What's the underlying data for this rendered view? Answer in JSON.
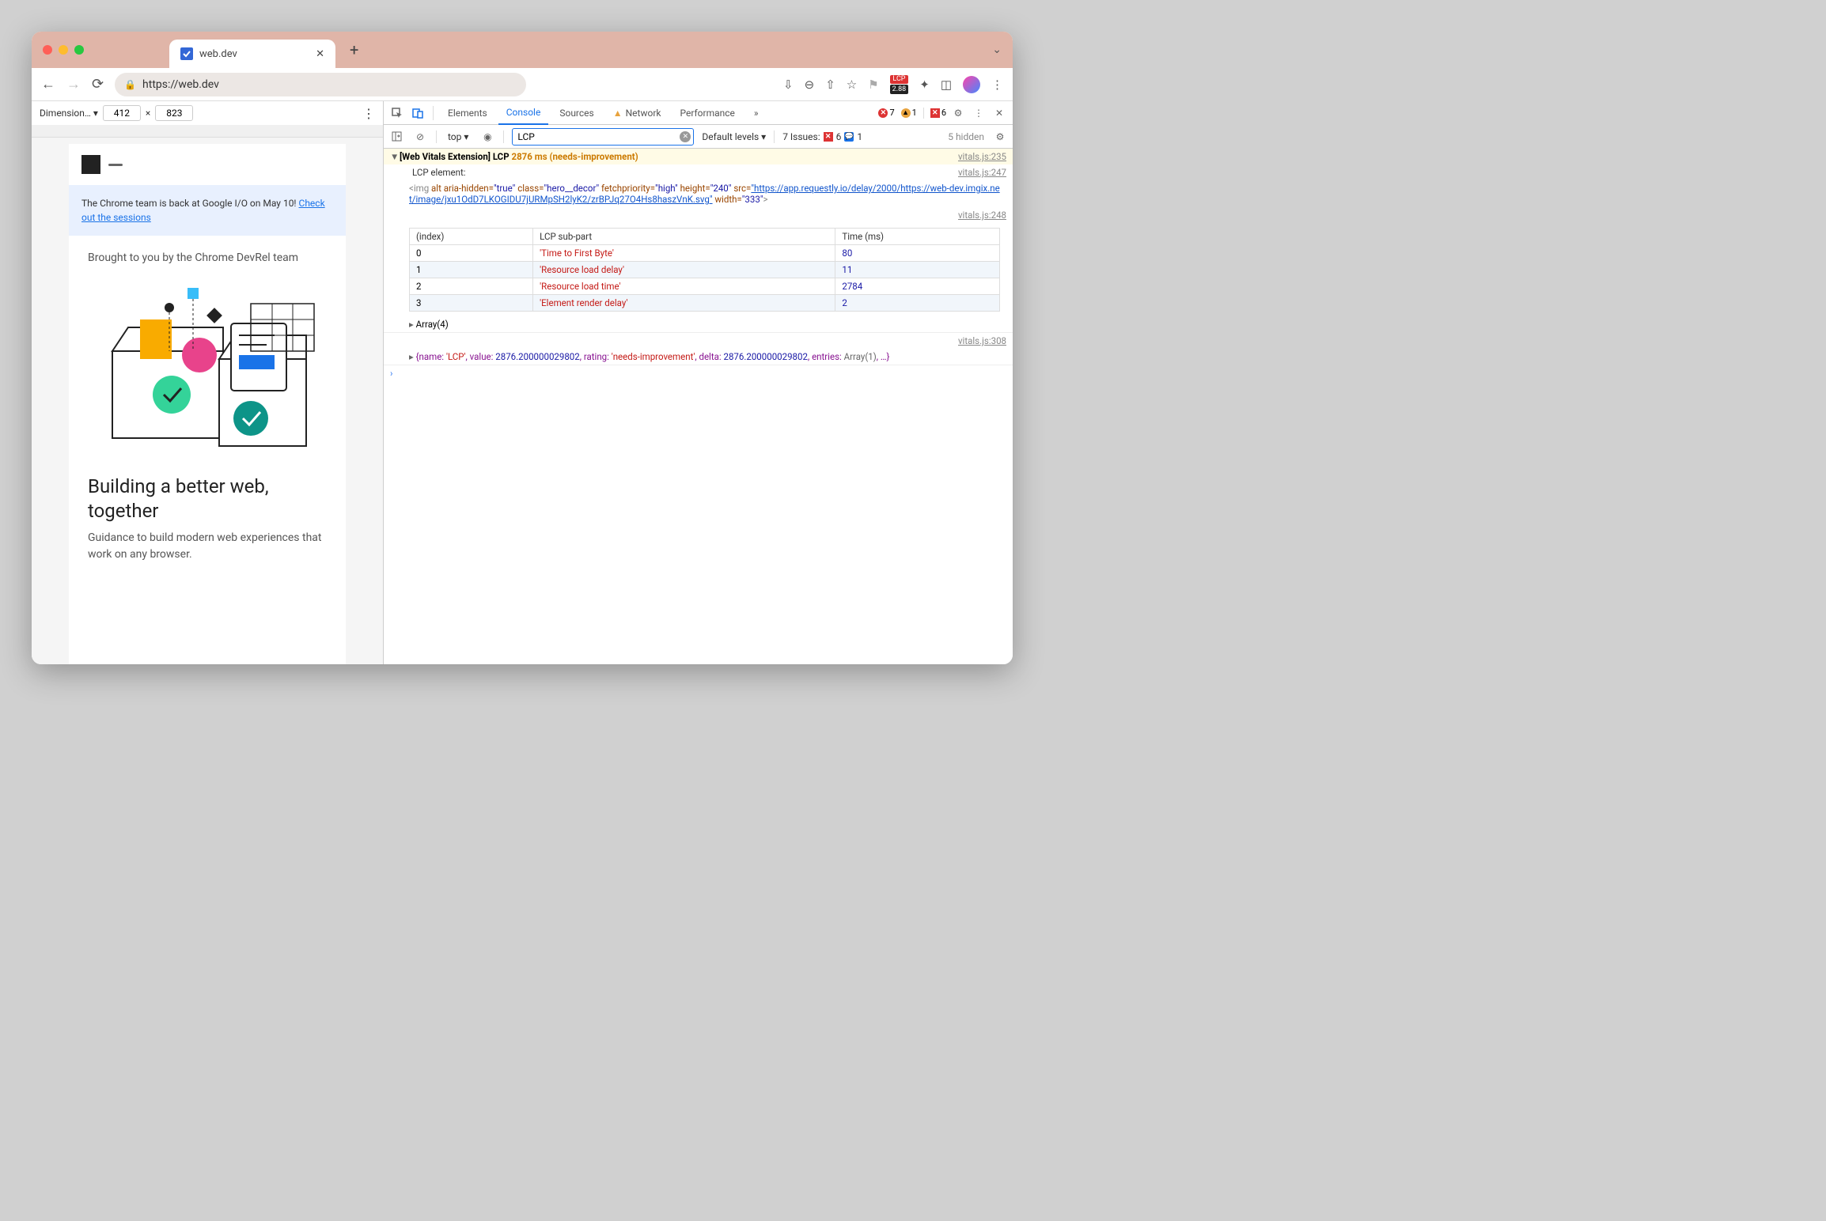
{
  "window": {
    "tab_title": "web.dev"
  },
  "address_bar": {
    "url": "https://web.dev",
    "lcp_badge": "LCP",
    "lcp_value": "2.88"
  },
  "device_toolbar": {
    "dimension_label": "Dimension…",
    "width": "412",
    "height": "823",
    "sep": "×"
  },
  "page": {
    "banner_text": "The Chrome team is back at Google I/O on May 10! ",
    "banner_link": "Check out the sessions",
    "brought": "Brought to you by the Chrome DevRel team",
    "heading": "Building a better web, together",
    "subtext": "Guidance to build modern web experiences that work on any browser."
  },
  "devtools": {
    "tabs": [
      "Elements",
      "Console",
      "Sources",
      "Network",
      "Performance"
    ],
    "active_tab": "Console",
    "errors": "7",
    "warnings": "1",
    "blocked": "6",
    "filter": {
      "context": "top",
      "search": "LCP",
      "levels": "Default levels",
      "issues_label": "7 Issues:",
      "issues_err": "6",
      "issues_info": "1",
      "hidden": "5 hidden"
    },
    "log1": {
      "prefix": "[Web Vitals Extension] LCP",
      "ms": "2876 ms",
      "rating": "(needs-improvement)",
      "src": "vitals.js:235"
    },
    "log2": {
      "label": "LCP element:",
      "src": "vitals.js:247",
      "tag_open": "<img",
      "attrs": [
        {
          "name": "alt",
          "val": ""
        },
        {
          "name": "aria-hidden",
          "val": "\"true\""
        },
        {
          "name": "class",
          "val": "\"hero__decor\""
        },
        {
          "name": "fetchpriority",
          "val": "\"high\""
        },
        {
          "name": "height",
          "val": "\"240\""
        }
      ],
      "src_attr": "src=",
      "src_url": "\"https://app.requestly.io/delay/2000/https://web-dev.imgix.net/image/jxu1OdD7LKOGIDU7jURMpSH2lyK2/zrBPJq27O4Hs8haszVnK.svg\"",
      "width_attr": " width=",
      "width_val": "\"333\"",
      "tag_close": ">"
    },
    "table": {
      "src": "vitals.js:248",
      "headers": [
        "(index)",
        "LCP sub-part",
        "Time (ms)"
      ],
      "rows": [
        {
          "idx": "0",
          "part": "'Time to First Byte'",
          "ms": "80"
        },
        {
          "idx": "1",
          "part": "'Resource load delay'",
          "ms": "11"
        },
        {
          "idx": "2",
          "part": "'Resource load time'",
          "ms": "2784"
        },
        {
          "idx": "3",
          "part": "'Element render delay'",
          "ms": "2"
        }
      ],
      "array_label": "Array(4)"
    },
    "log3": {
      "src": "vitals.js:308",
      "text_parts": {
        "p1": "{name: ",
        "v1": "'LCP'",
        "p2": ", value: ",
        "v2": "2876.200000029802",
        "p3": ", rating: ",
        "v3": "'needs-improvement'",
        "p4": ", delta: ",
        "v4": "2876.200000029802",
        "p5": ", entries: ",
        "v5": "Array(1)",
        "p6": ", …}"
      }
    }
  }
}
